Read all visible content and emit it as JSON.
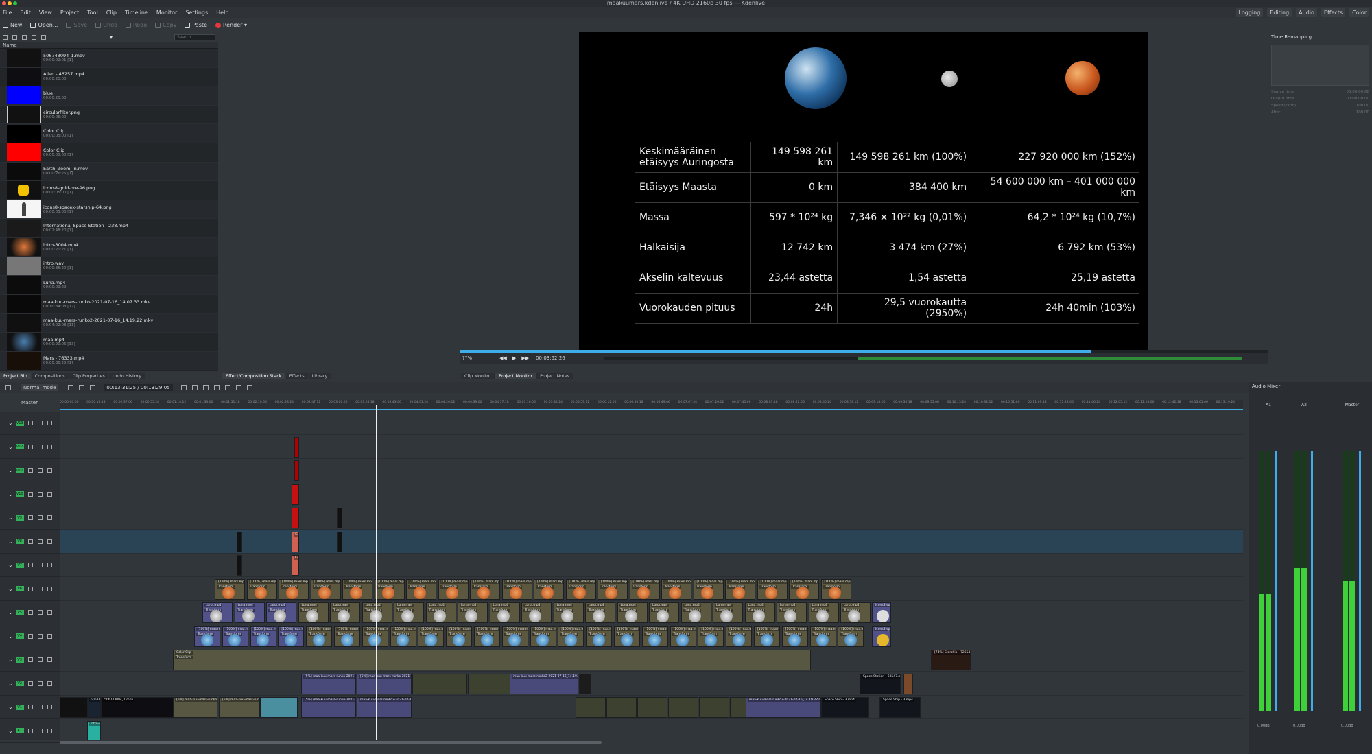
{
  "window": {
    "title": "maakuumars.kdenlive / 4K UHD 2160p 30 fps — Kdenlive"
  },
  "menu": [
    "File",
    "Edit",
    "View",
    "Project",
    "Tool",
    "Clip",
    "Timeline",
    "Monitor",
    "Settings",
    "Help"
  ],
  "toolbar": {
    "new": "New",
    "open": "Open...",
    "save": "Save",
    "undo": "Undo",
    "redo": "Redo",
    "copy": "Copy",
    "paste": "Paste",
    "render": "Render"
  },
  "layouts": [
    "Logging",
    "Editing",
    "Audio",
    "Effects",
    "Color"
  ],
  "bin": {
    "search_placeholder": "Search",
    "header": "Name",
    "clips": [
      {
        "name": "506743094_1.mov",
        "dur": "00:00:02:01 [1]"
      },
      {
        "name": "Alien - 46257.mp4",
        "dur": "00:00:20:00"
      },
      {
        "name": "blue",
        "dur": "00:00:20:00"
      },
      {
        "name": "circularfilter.png",
        "dur": "00:00:05:00"
      },
      {
        "name": "Color Clip",
        "dur": "00:00:05:00 [1]"
      },
      {
        "name": "Color Clip",
        "dur": "00:00:05:00 [1]"
      },
      {
        "name": "Earth_Zoom_In.mov",
        "dur": "00:00:26:25 [1]"
      },
      {
        "name": "icons8-gold-ore-96.png",
        "dur": "00:00:05:00 [1]"
      },
      {
        "name": "icons8-spacex-starship-64.png",
        "dur": "00:00:05:00 [1]"
      },
      {
        "name": "International Space Station - 238.mp4",
        "dur": "00:02:48:20 [1]"
      },
      {
        "name": "intro-3004.mp4",
        "dur": "00:00:20:21 [1]"
      },
      {
        "name": "intro.wav",
        "dur": "00:00:35:20 [1]"
      },
      {
        "name": "Luna.mp4",
        "dur": "00:00:09:29"
      },
      {
        "name": "maa-kuu-mars-runko-2021-07-16_14.07.33.mkv",
        "dur": "00:10:34:08 [17]"
      },
      {
        "name": "maa-kuu-mars-runko2-2021-07-16_14.19.22.mkv",
        "dur": "00:04:02:08 [11]"
      },
      {
        "name": "maa.mp4",
        "dur": "00:00:20:06 [33]"
      },
      {
        "name": "Mars - 76333.mp4",
        "dur": "00:00:36:25 [1]"
      }
    ]
  },
  "left_tabs": [
    "Project Bin",
    "Compositions",
    "Clip Properties",
    "Undo History"
  ],
  "mid_tabs": [
    "Effect/Composition Stack",
    "Effects",
    "Library"
  ],
  "monitor_tabs": [
    "Clip Monitor",
    "Project Monitor",
    "Project Notes"
  ],
  "monitor": {
    "zoom": "??%",
    "timecode": "00:03:52:26",
    "table": [
      [
        "Keskimääräinen etäisyys Auringosta",
        "149 598 261 km",
        "149 598 261 km (100%)",
        "227 920 000 km (152%)"
      ],
      [
        "Etäisyys Maasta",
        "0 km",
        "384 400 km",
        "54 600 000 km – 401 000 000 km"
      ],
      [
        "Massa",
        "597 * 10²⁴ kg",
        "7,346 × 10²² kg (0,01%)",
        "64,2 * 10²⁴ kg (10,7%)"
      ],
      [
        "Halkaisija",
        "12 742 km",
        "3 474 km (27%)",
        "6 792 km (53%)"
      ],
      [
        "Akselin kaltevuus",
        "23,44 astetta",
        "1,54 astetta",
        "25,19 astetta"
      ],
      [
        "Vuorokauden pituus",
        "24h",
        "29,5 vuorokautta (2950%)",
        "24h 40min (103%)"
      ]
    ]
  },
  "remap": {
    "title": "Time Remapping",
    "rows": [
      [
        "Source time",
        "00:00:00:00"
      ],
      [
        "Output time",
        "00:00:00:00"
      ],
      [
        "Speed (ratio)",
        "100.00"
      ],
      [
        "After",
        "100.00"
      ]
    ]
  },
  "timeline": {
    "mode": "Normal mode",
    "timecode": "00:13:31:25 / 00:13:29:05",
    "master": "Master",
    "ticks": [
      "00:00:00:00",
      "00:00:18:18",
      "00:00:37:06",
      "00:00:55:24",
      "00:01:14:12",
      "00:01:33:00",
      "00:01:51:18",
      "00:02:10:06",
      "00:02:28:24",
      "00:02:47:12",
      "00:03:06:00",
      "00:03:24:18",
      "00:03:43:06",
      "00:04:01:24",
      "00:04:20:12",
      "00:04:39:00",
      "00:04:57:18",
      "00:05:16:06",
      "00:05:34:24",
      "00:05:53:12",
      "00:06:12:00",
      "00:06:30:18",
      "00:06:49:06",
      "00:07:07:24",
      "00:07:26:12",
      "00:07:45:00",
      "00:08:03:18",
      "00:08:22:06",
      "00:08:40:24",
      "00:08:59:12",
      "00:09:18:00",
      "00:09:36:18",
      "00:09:55:06",
      "00:10:13:24",
      "00:10:32:12",
      "00:10:51:00",
      "00:11:09:18",
      "00:11:28:06",
      "00:11:46:24",
      "00:12:05:12",
      "00:12:24:00",
      "00:12:42:18",
      "00:13:01:06",
      "00:13:19:24"
    ],
    "tracks": [
      "V13",
      "V12",
      "V11",
      "V10",
      "V9",
      "V8",
      "V7",
      "V6",
      "V5",
      "V4",
      "V3",
      "V2",
      "V1",
      "A1"
    ],
    "clip_labels": {
      "mars": "[100%] mars.mp4",
      "luna": "Luna.mp4",
      "maa": "[100%] maa.mp4",
      "color": "Color Clip",
      "transform": "Transform",
      "runko": "[5%] maa-kuu-mars-runko-2021-07-16_14.07.33.mkv",
      "runko2": "maa-kuu-mars-runko2-2021-07-16_14.19.22.mkv",
      "movclip": "506743094_1.mov",
      "intro": "intro-3",
      "starship": "[74%] Starship - 72654.mp4",
      "station": "Space Station - 60547.mp4",
      "spaceship": "Space Ship - 3.mp4",
      "icon": "icons8-sp"
    }
  },
  "mixer": {
    "title": "Audio Mixer",
    "strips": [
      {
        "name": "A1",
        "db": "0.00dB",
        "level": 0.45
      },
      {
        "name": "A2",
        "db": "0.00dB",
        "level": 0.55
      },
      {
        "name": "Master",
        "db": "0.00dB",
        "level": 0.5
      }
    ]
  },
  "colors": {
    "accent": "#3daee9",
    "track_tag": "#35b05a",
    "panel": "#31363b",
    "clip_video": "#57577a",
    "clip_color": "#575742",
    "meter": "#3fd13a"
  }
}
